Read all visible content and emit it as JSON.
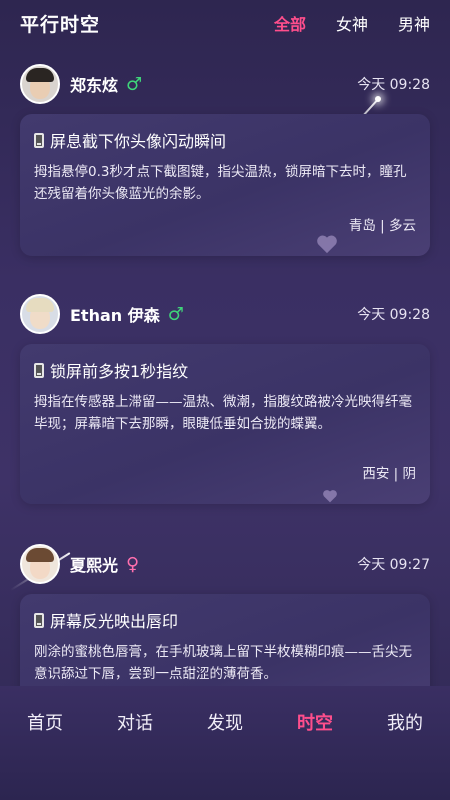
{
  "header": {
    "app_title": "平行时空",
    "filters": [
      "全部",
      "女神",
      "男神"
    ],
    "active_filter": "全部"
  },
  "posts": [
    {
      "name": "郑东炫",
      "gender_symbol": "♂",
      "time": "今天 09:28",
      "title": "屏息截下你头像闪动瞬间",
      "body": "拇指悬停0.3秒才点下截图键，指尖温热，锁屏暗下去时，瞳孔还残留着你头像蓝光的余影。",
      "location": "青岛 | 多云"
    },
    {
      "name": "Ethan 伊森",
      "gender_symbol": "♂",
      "time": "今天 09:28",
      "title": "锁屏前多按1秒指纹",
      "body": "拇指在传感器上滞留——温热、微潮，指腹纹路被冷光映得纤毫毕现；屏幕暗下去那瞬，眼睫低垂如合拢的蝶翼。",
      "location": "西安 | 阴"
    },
    {
      "name": "夏熙光",
      "gender_symbol": "♀",
      "time": "今天 09:27",
      "title": "屏幕反光映出唇印",
      "body": "刚涂的蜜桃色唇膏，在手机玻璃上留下半枚模糊印痕——舌尖无意识舔过下唇，尝到一点甜涩的薄荷香。",
      "location": ""
    }
  ],
  "nav": {
    "items": [
      "首页",
      "对话",
      "发现",
      "时空",
      "我的"
    ],
    "active": "时空"
  },
  "colors": {
    "accent": "#ff4e8c",
    "male": "#3fd67a",
    "female": "#ff6fae"
  },
  "icons": {
    "post_title_icon": "mobile-phone-icon",
    "male": "male-symbol-icon",
    "female": "female-symbol-icon"
  }
}
